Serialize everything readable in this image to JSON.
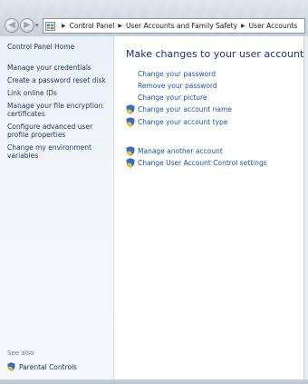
{
  "navigation": {
    "back_icon": "back-arrow-icon",
    "forward_icon": "forward-arrow-icon",
    "breadcrumb": [
      "Control Panel",
      "User Accounts and Family Safety",
      "User Accounts"
    ]
  },
  "sidebar": {
    "home": "Control Panel Home",
    "links": [
      "Manage your credentials",
      "Create a password reset disk",
      "Link online IDs",
      "Manage your file encryption certificates",
      "Configure advanced user profile properties",
      "Change my environment variables"
    ],
    "see_also_label": "See also",
    "see_also_links": [
      "Parental Controls"
    ]
  },
  "main": {
    "title": "Make changes to your user account",
    "tasks": [
      {
        "label": "Change your password",
        "shield": false
      },
      {
        "label": "Remove your password",
        "shield": false
      },
      {
        "label": "Change your picture",
        "shield": false
      },
      {
        "label": "Change your account name",
        "shield": true
      },
      {
        "label": "Change your account type",
        "shield": true
      }
    ],
    "admin_tasks": [
      {
        "label": "Manage another account",
        "shield": true
      },
      {
        "label": "Change User Account Control settings",
        "shield": true
      }
    ]
  },
  "colors": {
    "title": "#1e3287",
    "link": "#1a56a8",
    "sidebar_link": "#1e395b",
    "sidebar_bg": "#eef3f9"
  }
}
